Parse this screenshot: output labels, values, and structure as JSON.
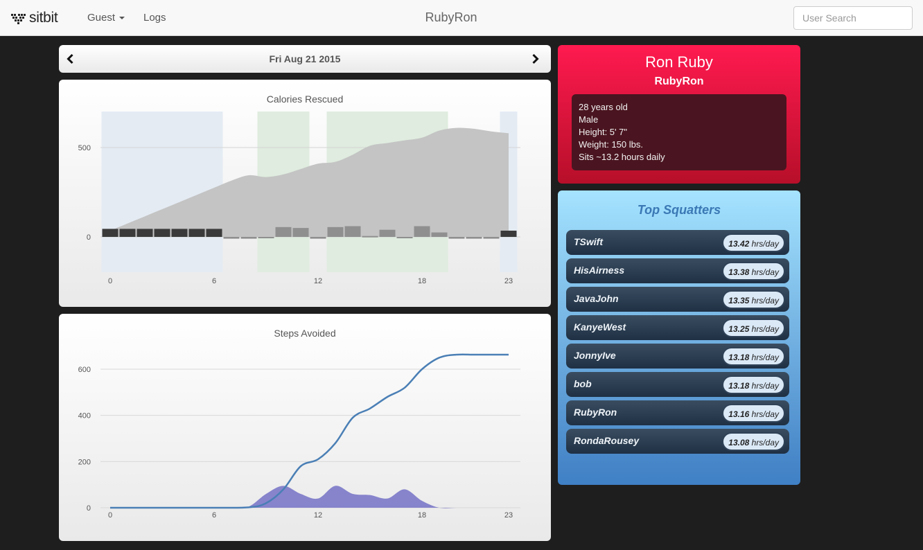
{
  "nav": {
    "brand": "sitbit",
    "guest_label": "Guest",
    "logs_label": "Logs",
    "title": "RubyRon",
    "search_placeholder": "User Search"
  },
  "date_bar": {
    "date": "Fri Aug 21 2015"
  },
  "profile": {
    "name": "Ron Ruby",
    "username": "RubyRon",
    "details": [
      "28 years old",
      "Male",
      "Height: 5' 7\"",
      "Weight: 150 lbs.",
      "Sits ~13.2 hours daily"
    ]
  },
  "leaderboard": {
    "title": "Top Squatters",
    "unit": "hrs/day",
    "rows": [
      {
        "name": "TSwift",
        "value": "13.42"
      },
      {
        "name": "HisAirness",
        "value": "13.38"
      },
      {
        "name": "JavaJohn",
        "value": "13.35"
      },
      {
        "name": "KanyeWest",
        "value": "13.25"
      },
      {
        "name": "JonnyIve",
        "value": "13.18"
      },
      {
        "name": "bob",
        "value": "13.18"
      },
      {
        "name": "RubyRon",
        "value": "13.16"
      },
      {
        "name": "RondaRousey",
        "value": "13.08"
      }
    ]
  },
  "colors": {
    "profile_top": "#ff1a4f",
    "leaderboard_title": "#3a78b5",
    "steps_line": "#4a7fb5",
    "steps_area": "#7b78c8",
    "calories_area": "#c4c4c4",
    "sit_band": "#e4ebf3",
    "active_band": "#dfecdf"
  },
  "chart_data": [
    {
      "type": "area",
      "title": "Calories Rescued",
      "x_ticks": [
        0,
        6,
        12,
        18,
        23
      ],
      "y_ticks": [
        0,
        500
      ],
      "ylim": [
        -200,
        700
      ],
      "grid": true,
      "bands": [
        {
          "from": -0.5,
          "to": 6.5,
          "kind": "sitting"
        },
        {
          "from": 8.5,
          "to": 11.5,
          "kind": "active"
        },
        {
          "from": 12.5,
          "to": 19.5,
          "kind": "active"
        },
        {
          "from": 22.5,
          "to": 23.5,
          "kind": "sitting"
        }
      ],
      "cumulative": {
        "x": [
          0,
          1,
          2,
          3,
          4,
          5,
          6,
          7,
          8,
          9,
          10,
          11,
          12,
          13,
          14,
          15,
          16,
          17,
          18,
          19,
          20,
          21,
          22,
          23
        ],
        "values": [
          35,
          75,
          115,
          155,
          195,
          235,
          275,
          315,
          345,
          335,
          350,
          380,
          410,
          420,
          460,
          510,
          525,
          540,
          555,
          595,
          610,
          605,
          590,
          580
        ]
      },
      "hourly": {
        "x": [
          0,
          1,
          2,
          3,
          4,
          5,
          6,
          7,
          8,
          9,
          10,
          11,
          12,
          13,
          14,
          15,
          16,
          17,
          18,
          19,
          20,
          21,
          22,
          23
        ],
        "values": [
          45,
          45,
          45,
          45,
          45,
          45,
          45,
          -10,
          -10,
          -5,
          55,
          50,
          -10,
          55,
          60,
          5,
          40,
          -5,
          60,
          25,
          -10,
          -10,
          -10,
          35
        ]
      }
    },
    {
      "type": "line",
      "title": "Steps Avoided",
      "x_ticks": [
        0,
        6,
        12,
        18,
        23
      ],
      "y_ticks": [
        0,
        200,
        400,
        600
      ],
      "ylim": [
        0,
        700
      ],
      "grid": true,
      "series": [
        {
          "kind": "line",
          "x": [
            0,
            6,
            8,
            9,
            10,
            11,
            12,
            13,
            14,
            15,
            16,
            17,
            18,
            19,
            20,
            21,
            22,
            23
          ],
          "values": [
            0,
            0,
            2,
            20,
            80,
            180,
            210,
            280,
            390,
            430,
            480,
            520,
            600,
            650,
            663,
            663,
            663,
            663
          ]
        },
        {
          "kind": "area",
          "x": [
            0,
            6,
            7,
            8,
            9,
            10,
            11,
            12,
            13,
            14,
            15,
            16,
            17,
            18,
            19,
            20,
            21,
            22,
            23
          ],
          "values": [
            0,
            0,
            0,
            5,
            60,
            95,
            60,
            40,
            95,
            60,
            55,
            40,
            80,
            30,
            0,
            0,
            0,
            0,
            0
          ]
        }
      ]
    }
  ]
}
